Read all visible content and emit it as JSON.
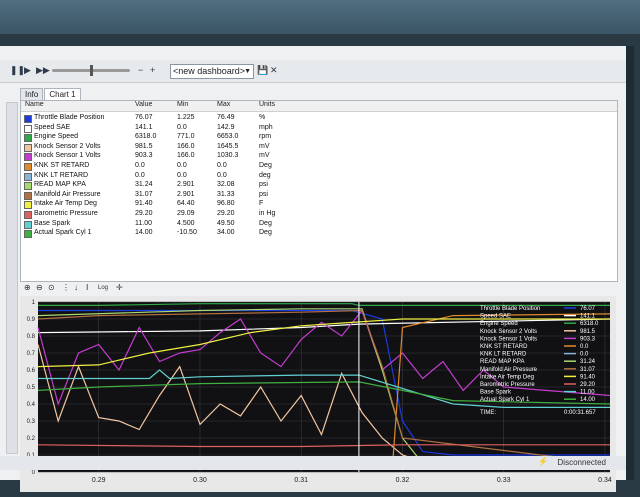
{
  "toolbar": {
    "dashboard_select": "<new dashboard>",
    "zoom_in_label": "+",
    "zoom_out_label": "−",
    "play_label": "▶",
    "pause_label": "❚❚",
    "ff_label": "▶▶",
    "save_label": "💾",
    "close_label": "✕"
  },
  "tabs": [
    {
      "label": "Info"
    },
    {
      "label": "Chart 1"
    }
  ],
  "table": {
    "headers": [
      "Name",
      "Value",
      "Min",
      "Max",
      "Units"
    ],
    "rows": [
      {
        "name": "Throttle Blade Position",
        "value": "76.07",
        "min": "1.225",
        "max": "76.49",
        "units": "%",
        "color": "#1a3be0"
      },
      {
        "name": "Speed SAE",
        "value": "141.1",
        "min": "0.0",
        "max": "142.9",
        "units": "mph",
        "color": "#ffffff"
      },
      {
        "name": "Engine Speed",
        "value": "6318.0",
        "min": "771.0",
        "max": "6653.0",
        "units": "rpm",
        "color": "#2fa847"
      },
      {
        "name": "Knock Sensor 2 Volts",
        "value": "981.5",
        "min": "166.0",
        "max": "1645.5",
        "units": "mV",
        "color": "#f2c7a0"
      },
      {
        "name": "Knock Sensor 1 Volts",
        "value": "903.3",
        "min": "166.0",
        "max": "1030.3",
        "units": "mV",
        "color": "#c43ccf"
      },
      {
        "name": "KNK ST RETARD",
        "value": "0.0",
        "min": "0.0",
        "max": "0.0",
        "units": "Deg",
        "color": "#e08a2a"
      },
      {
        "name": "KNK LT RETARD",
        "value": "0.0",
        "min": "0.0",
        "max": "0.0",
        "units": "deg",
        "color": "#8ab4d8"
      },
      {
        "name": "READ MAP KPA",
        "value": "31.24",
        "min": "2.901",
        "max": "32.08",
        "units": "psi",
        "color": "#a8d86e"
      },
      {
        "name": "Manifold Air Pressure",
        "value": "31.07",
        "min": "2.901",
        "max": "31.33",
        "units": "psi",
        "color": "#b07040"
      },
      {
        "name": "Intake Air Temp Deg",
        "value": "91.40",
        "min": "64.40",
        "max": "96.80",
        "units": "F",
        "color": "#f0f040"
      },
      {
        "name": "Barometric Pressure",
        "value": "29.20",
        "min": "29.09",
        "max": "29.20",
        "units": "in Hg",
        "color": "#e06060"
      },
      {
        "name": "Base Spark",
        "value": "11.00",
        "min": "4.500",
        "max": "49.50",
        "units": "Deg",
        "color": "#60d0d0"
      },
      {
        "name": "Actual Spark Cyl 1",
        "value": "14.00",
        "min": "-10.50",
        "max": "34.00",
        "units": "Deg",
        "color": "#40b040"
      }
    ]
  },
  "chart_tools": {
    "log_label": "Log"
  },
  "chart_legend": [
    {
      "label": "Throttle Blade Position",
      "value": "76.07"
    },
    {
      "label": "Speed SAE",
      "value": "141.1"
    },
    {
      "label": "Engine Speed",
      "value": "6318.0"
    },
    {
      "label": "Knock Sensor 2 Volts",
      "value": "981.5"
    },
    {
      "label": "Knock Sensor 1 Volts",
      "value": "903.3"
    },
    {
      "label": "KNK ST RETARD",
      "value": "0.0"
    },
    {
      "label": "KNK LT RETARD",
      "value": "0.0"
    },
    {
      "label": "READ MAP KPA",
      "value": "31.24"
    },
    {
      "label": "Manifold Air Pressure",
      "value": "31.07"
    },
    {
      "label": "Intake Air Temp Deg",
      "value": "91.40"
    },
    {
      "label": "Barometric Pressure",
      "value": "29.20"
    },
    {
      "label": "Base Spark",
      "value": "11.00"
    },
    {
      "label": "Actual Spark Cyl 1",
      "value": "14.00"
    }
  ],
  "chart_time": {
    "label": "TIME:",
    "value": "0:00:31.657"
  },
  "status": {
    "text": "Disconnected"
  },
  "chart_data": {
    "type": "line",
    "x_ticks": [
      "0.29",
      "0.30",
      "0.31",
      "0.32",
      "0.33",
      "0.34"
    ],
    "y_ticks": [
      "0",
      "0.1",
      "0.2",
      "0.3",
      "0.4",
      "0.5",
      "0.6",
      "0.7",
      "0.8",
      "0.9",
      "1"
    ],
    "ylim": [
      0,
      1
    ],
    "xlim": [
      0.284,
      0.3405
    ],
    "cursor_x": 0.3157,
    "series": [
      {
        "color": "#1a3be0",
        "x": [
          0.284,
          0.3,
          0.31,
          0.315,
          0.318,
          0.32,
          0.322,
          0.325,
          0.33,
          0.335,
          0.3405
        ],
        "y": [
          0.95,
          0.95,
          0.95,
          0.95,
          0.9,
          0.3,
          0.12,
          0.1,
          0.1,
          0.1,
          0.1
        ]
      },
      {
        "color": "#ffffff",
        "x": [
          0.284,
          0.3,
          0.31,
          0.3157,
          0.3405
        ],
        "y": [
          0.82,
          0.83,
          0.85,
          0.87,
          0.9
        ]
      },
      {
        "color": "#2fa847",
        "x": [
          0.284,
          0.29,
          0.3,
          0.31,
          0.315,
          0.3157,
          0.3405
        ],
        "y": [
          0.98,
          0.98,
          0.99,
          0.99,
          0.99,
          0.98,
          0.98
        ]
      },
      {
        "color": "#f2c7a0",
        "x": [
          0.284,
          0.286,
          0.288,
          0.29,
          0.292,
          0.294,
          0.296,
          0.298,
          0.3,
          0.302,
          0.304,
          0.306,
          0.308,
          0.31,
          0.312,
          0.314,
          0.316,
          0.318,
          0.32,
          0.322,
          0.324,
          0.326,
          0.328,
          0.33
        ],
        "y": [
          0.75,
          0.3,
          0.62,
          0.32,
          0.3,
          0.25,
          0.45,
          0.62,
          0.28,
          0.4,
          0.33,
          0.5,
          0.3,
          0.45,
          0.22,
          0.58,
          0.35,
          0.2,
          0.1,
          0.06,
          0.05,
          0.04,
          0.04,
          0.04
        ]
      },
      {
        "color": "#c43ccf",
        "x": [
          0.284,
          0.286,
          0.288,
          0.29,
          0.292,
          0.294,
          0.296,
          0.298,
          0.3,
          0.302,
          0.304,
          0.306,
          0.308,
          0.31,
          0.312,
          0.314,
          0.316,
          0.318,
          0.32,
          0.322,
          0.324,
          0.326,
          0.328,
          0.33,
          0.3405
        ],
        "y": [
          0.85,
          0.4,
          0.7,
          0.75,
          0.6,
          0.85,
          0.65,
          0.7,
          0.72,
          0.82,
          0.9,
          0.7,
          0.62,
          0.78,
          0.88,
          0.8,
          0.95,
          0.6,
          0.7,
          0.55,
          0.65,
          0.48,
          0.6,
          0.5,
          0.45
        ]
      },
      {
        "color": "#e08a2a",
        "x": [
          0.284,
          0.318,
          0.319,
          0.32,
          0.325,
          0.3405
        ],
        "y": [
          0.02,
          0.02,
          0.02,
          0.85,
          0.92,
          0.93
        ]
      },
      {
        "color": "#8ab4d8",
        "x": [
          0.284,
          0.31,
          0.3157,
          0.32,
          0.325,
          0.3405
        ],
        "y": [
          0.02,
          0.02,
          0.02,
          0.02,
          0.02,
          0.02
        ]
      },
      {
        "color": "#a8d86e",
        "x": [
          0.284,
          0.3,
          0.31,
          0.316,
          0.318,
          0.32,
          0.322,
          0.33
        ],
        "y": [
          0.92,
          0.95,
          0.96,
          0.96,
          0.6,
          0.2,
          0.05,
          0.03
        ]
      },
      {
        "color": "#b07040",
        "x": [
          0.284,
          0.29,
          0.3,
          0.31,
          0.316,
          0.318,
          0.32,
          0.3405
        ],
        "y": [
          0.9,
          0.92,
          0.93,
          0.94,
          0.95,
          0.62,
          0.2,
          0.05
        ]
      },
      {
        "color": "#f0f040",
        "x": [
          0.284,
          0.29,
          0.295,
          0.3,
          0.305,
          0.31,
          0.315,
          0.32,
          0.33,
          0.3405
        ],
        "y": [
          0.62,
          0.63,
          0.7,
          0.75,
          0.82,
          0.86,
          0.88,
          0.9,
          0.9,
          0.9
        ]
      },
      {
        "color": "#e06060",
        "x": [
          0.284,
          0.3,
          0.31,
          0.32,
          0.33,
          0.3405
        ],
        "y": [
          0.16,
          0.15,
          0.15,
          0.16,
          0.16,
          0.16
        ]
      },
      {
        "color": "#60d0d0",
        "x": [
          0.284,
          0.295,
          0.296,
          0.297,
          0.3,
          0.31,
          0.3157,
          0.325,
          0.33,
          0.3405
        ],
        "y": [
          0.55,
          0.55,
          0.6,
          0.55,
          0.56,
          0.57,
          0.57,
          0.4,
          0.38,
          0.38
        ]
      },
      {
        "color": "#40b040",
        "x": [
          0.284,
          0.29,
          0.3,
          0.3157,
          0.32,
          0.325,
          0.3405
        ],
        "y": [
          0.48,
          0.5,
          0.52,
          0.53,
          0.48,
          0.42,
          0.4
        ]
      }
    ]
  }
}
